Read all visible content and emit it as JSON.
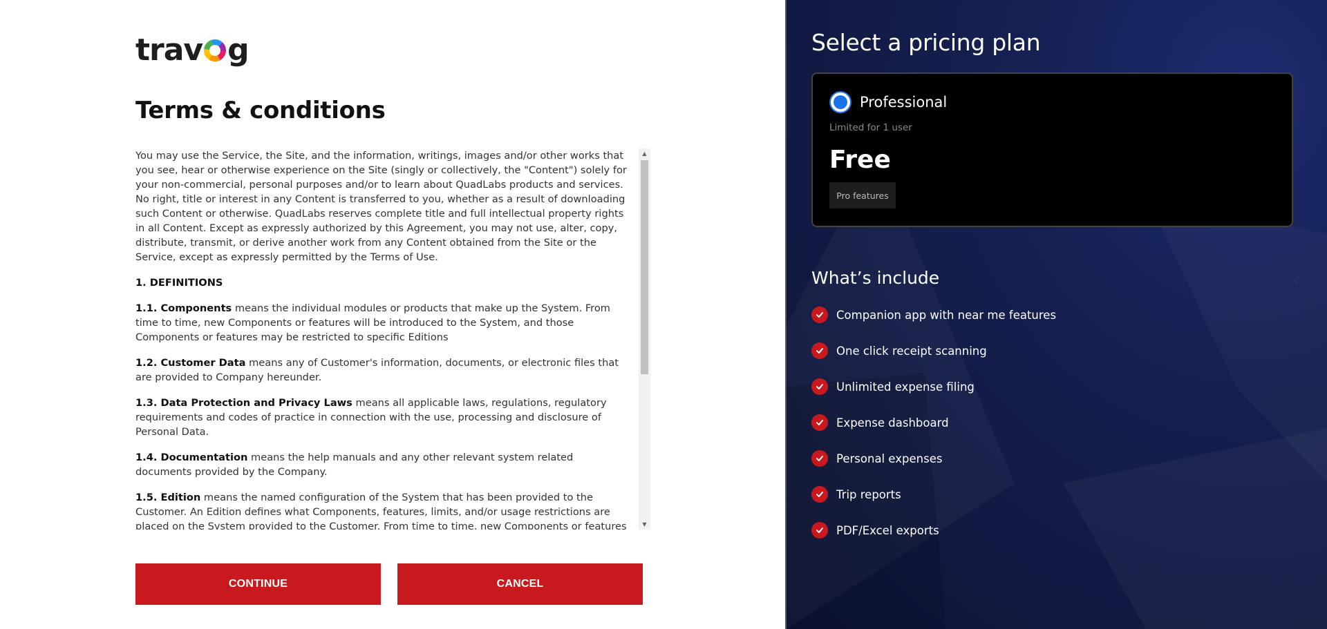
{
  "logo": {
    "text_before": "trav",
    "text_after": "g"
  },
  "terms": {
    "title": "Terms & conditions",
    "intro": "You may use the Service, the Site, and the information, writings, images and/or other works that you see, hear or otherwise experience on the Site (singly or collectively, the \"Content\") solely for your non-commercial, personal purposes and/or to learn about QuadLabs products and services. No right, title or interest in any Content is transferred to you, whether as a result of downloading such Content or otherwise. QuadLabs reserves complete title and full intellectual property rights in all Content. Except as expressly authorized by this Agreement, you may not use, alter, copy, distribute, transmit, or derive another work from any Content obtained from the Site or the Service, except as expressly permitted by the Terms of Use.",
    "section_heading": "1. DEFINITIONS",
    "definitions": [
      {
        "term": "1.1. Components",
        "text": " means the individual modules or products that make up the System. From time to time, new Components or features will be introduced to the System, and those Components or features may be restricted to specific Editions"
      },
      {
        "term": "1.2. Customer Data",
        "text": " means any of Customer's information, documents, or electronic files that are provided to Company hereunder."
      },
      {
        "term": "1.3. Data Protection and Privacy Laws",
        "text": " means all applicable laws, regulations, regulatory requirements and codes of practice in connection with the use, processing and disclosure of Personal Data."
      },
      {
        "term": "1.4. Documentation",
        "text": " means the help manuals and any other relevant system related documents provided by the Company."
      },
      {
        "term": "1.5. Edition",
        "text": " means the named configuration of the System that has been provided to the Customer. An Edition defines what Components, features, limits, and/or usage restrictions are placed on the System provided to the Customer. From time to time, new Components or features will be introduced"
      }
    ]
  },
  "buttons": {
    "continue": "CONTINUE",
    "cancel": "CANCEL"
  },
  "pricing": {
    "title": "Select a pricing plan",
    "plan": {
      "name": "Professional",
      "limit": "Limited for 1 user",
      "price": "Free",
      "features_button": "Pro features",
      "selected": true
    },
    "include_title": "What’s include",
    "features": [
      "Companion app with near me features",
      "One click receipt scanning",
      "Unlimited expense filing",
      "Expense dashboard",
      "Personal expenses",
      "Trip reports",
      "PDF/Excel exports"
    ]
  },
  "colors": {
    "accent_red": "#c8191f",
    "radio_blue": "#1a73e8",
    "panel_dark": "#15204f"
  },
  "icons": {
    "check": "check-circle-icon",
    "close": "close-icon",
    "scroll_up": "scroll-up-arrow",
    "scroll_down": "scroll-down-arrow"
  }
}
